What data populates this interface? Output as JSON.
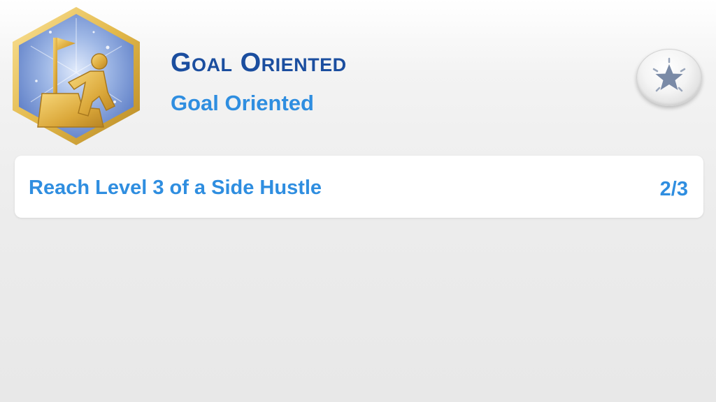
{
  "aspiration": {
    "title": "Goal Oriented",
    "subtitle": "Goal Oriented",
    "badge_icon": "climbing-figure-with-flag-icon",
    "favorite_icon": "star-icon"
  },
  "goals": [
    {
      "label": "Reach Level 3 of a Side Hustle",
      "progress": "2/3",
      "current": 2,
      "total": 3
    }
  ],
  "colors": {
    "title": "#1b4e9f",
    "accent_text": "#2f8ee0",
    "badge_frame": "#e2b84a",
    "badge_background": "#7e9dd9",
    "badge_figure": "#e0b243",
    "star": "#7a8aa6"
  }
}
